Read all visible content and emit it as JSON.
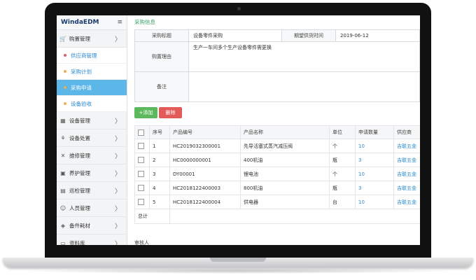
{
  "brand": {
    "name": "WindaEDM",
    "menu_icon": "menu-icon"
  },
  "sidebar": {
    "items": [
      {
        "label": "购置管理",
        "icon": "cart-icon",
        "glyph": "🛒",
        "chev": "〉"
      },
      {
        "label": "设备管理",
        "icon": "grid-icon",
        "glyph": "▦",
        "chev": "〉"
      },
      {
        "label": "设备处置",
        "icon": "share-icon",
        "glyph": "⚘",
        "chev": "〉"
      },
      {
        "label": "维修管理",
        "icon": "wrench-icon",
        "glyph": "✕",
        "chev": "〉"
      },
      {
        "label": "养护管理",
        "icon": "image-icon",
        "glyph": "▣",
        "chev": "〉"
      },
      {
        "label": "巡检管理",
        "icon": "calendar-icon",
        "glyph": "▤",
        "chev": "〉"
      },
      {
        "label": "人员管理",
        "icon": "user-icon",
        "glyph": "☺",
        "chev": "〉"
      },
      {
        "label": "备件耗材",
        "icon": "cube-icon",
        "glyph": "◈",
        "chev": "〉"
      },
      {
        "label": "资料库",
        "icon": "storage-icon",
        "glyph": "▭",
        "chev": "〉"
      }
    ],
    "sub_items": [
      {
        "label": "供应商管理",
        "dot_color": "#e05d6f"
      },
      {
        "label": "采购计划",
        "dot_color": "#f0ad4e"
      },
      {
        "label": "采购申请",
        "dot_color": "#f0ad4e"
      },
      {
        "label": "设备验收",
        "dot_color": "#f0ad4e"
      }
    ]
  },
  "section_title": "采购信息",
  "form": {
    "title_label": "采购标题",
    "title_value": "设备零件采购",
    "date_label": "期望供货时间",
    "date_value": "2019-06-12",
    "reason_label": "购置理由",
    "reason_value": "生产一车间多个生产设备零件需更换",
    "remark_label": "备注",
    "remark_value": ""
  },
  "buttons": {
    "add": "+添加",
    "delete": "删除"
  },
  "table": {
    "headers": [
      "序号",
      "产品编号",
      "产品名称",
      "单位",
      "申请数量",
      "供应商"
    ],
    "rows": [
      {
        "no": "1",
        "code": "HC2019032300001",
        "name": "先导活塞式蒸汽减压阀",
        "unit": "个",
        "qty": "10",
        "supplier": "吉联五金"
      },
      {
        "no": "2",
        "code": "HC0000000001",
        "name": "400机油",
        "unit": "瓶",
        "qty": "3",
        "supplier": "吉联五金"
      },
      {
        "no": "3",
        "code": "DY00001",
        "name": "锂电池",
        "unit": "个",
        "qty": "10",
        "supplier": "吉联五金"
      },
      {
        "no": "4",
        "code": "HC2018122400003",
        "name": "800机油",
        "unit": "瓶",
        "qty": "3",
        "supplier": "吉联五金"
      },
      {
        "no": "5",
        "code": "HC2018122400004",
        "name": "供电器",
        "unit": "台",
        "qty": "10",
        "supplier": "吉联五金"
      }
    ],
    "total_label": "总计"
  },
  "reviewer_label": "审核人",
  "colors": {
    "accent": "#5db6e8",
    "link": "#2b8ad1",
    "add": "#5cb85c",
    "delete": "#e25b58",
    "title_green": "#3aa06d"
  }
}
